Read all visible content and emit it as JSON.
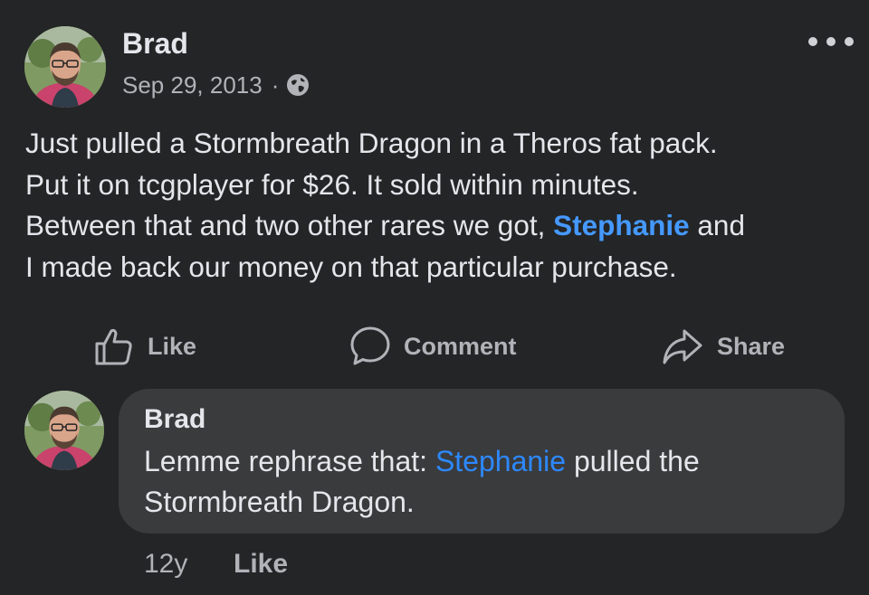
{
  "post": {
    "author": "Brad",
    "date": "Sep 29, 2013",
    "separator": "·",
    "privacy_icon": "globe-icon",
    "more_icon": "more-options-icon",
    "body_lines": [
      "Just pulled a Stormbreath Dragon in a Theros fat pack.",
      "Put it on tcgplayer for $26. It sold within minutes.",
      "Between that and two other rares we got,",
      "I made back our money on that particular purchase."
    ],
    "mention": "Stephanie",
    "mention_after": " and"
  },
  "actions": {
    "like_label": "Like",
    "like_icon": "thumbs-up-icon",
    "comment_label": "Comment",
    "comment_icon": "comment-bubble-icon",
    "share_label": "Share",
    "share_icon": "share-arrow-icon"
  },
  "comment": {
    "author": "Brad",
    "text_before": "Lemme rephrase that: ",
    "mention": "Stephanie",
    "text_after": " pulled the",
    "text_line2": "Stormbreath Dragon.",
    "time": "12y",
    "like_label": "Like"
  },
  "colors": {
    "background": "#242526",
    "bubble": "#3a3b3c",
    "text_primary": "#e4e6eb",
    "text_secondary": "#b0b3b8",
    "mention_post": "#4599ff",
    "mention_comment": "#2d88ff"
  }
}
